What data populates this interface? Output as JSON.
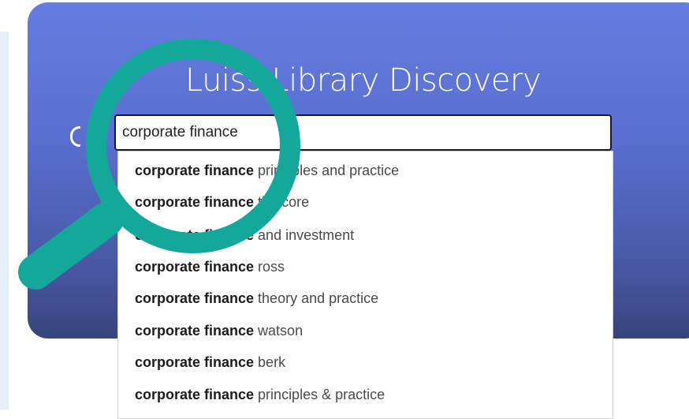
{
  "hero": {
    "title": "Luiss Library Discovery"
  },
  "search": {
    "value": "corporate finance"
  },
  "suggestions": [
    {
      "match": "corporate finance",
      "rest": " principles and practice"
    },
    {
      "match": "corporate finance",
      "rest": " the core"
    },
    {
      "match": "corporate finance",
      "rest": " and investment"
    },
    {
      "match": "corporate finance",
      "rest": " ross"
    },
    {
      "match": "corporate finance",
      "rest": " theory and practice"
    },
    {
      "match": "corporate finance",
      "rest": " watson"
    },
    {
      "match": "corporate finance",
      "rest": " berk"
    },
    {
      "match": "corporate finance",
      "rest": " principles & practice"
    }
  ],
  "colors": {
    "magnifier": "#14a89a",
    "hero_top": "#647de0",
    "hero_bottom": "#37447a"
  },
  "icons": {
    "overlay": "magnifying-glass",
    "left_partial": "partial-glyph"
  }
}
